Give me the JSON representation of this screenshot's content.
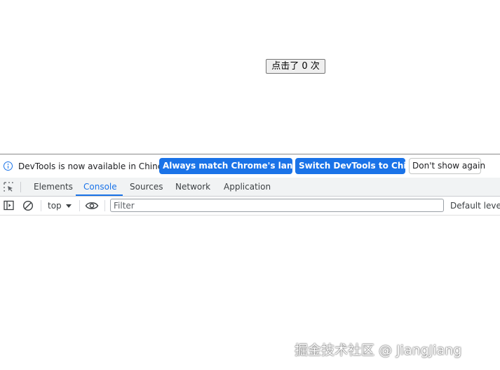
{
  "page": {
    "counter_button_label": "点击了 0 次"
  },
  "devtools": {
    "infobar": {
      "message": "DevTools is now available in Chinese!",
      "match_language_label": "Always match Chrome's language",
      "switch_label": "Switch DevTools to Chinese",
      "dismiss_label": "Don't show again",
      "icon": "info-icon"
    },
    "tabs": [
      {
        "label": "Elements",
        "active": false
      },
      {
        "label": "Console",
        "active": true
      },
      {
        "label": "Sources",
        "active": false
      },
      {
        "label": "Network",
        "active": false
      },
      {
        "label": "Application",
        "active": false
      }
    ],
    "toolbar": {
      "context": "top",
      "filter_placeholder": "Filter",
      "levels_label": "Default levels"
    },
    "colors": {
      "accent": "#1a73e8"
    }
  },
  "watermark": "掘金技术社区 @ JiangJiang"
}
